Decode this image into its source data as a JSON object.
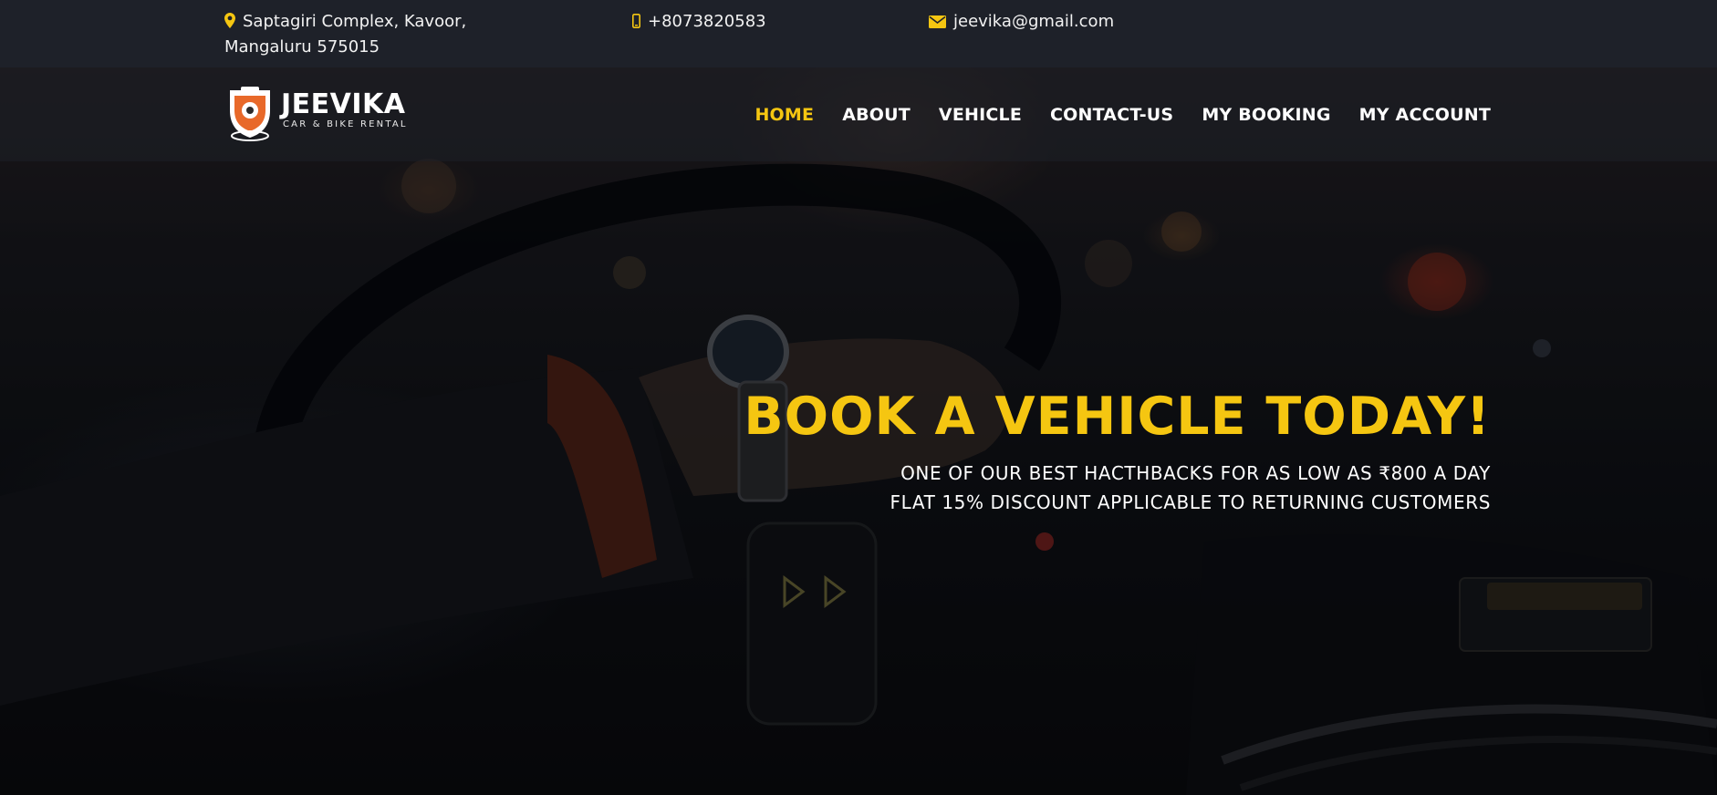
{
  "topbar": {
    "address": "Saptagiri Complex, Kavoor, Mangaluru 575015",
    "address_icon": "map-marker-icon",
    "phone": "+8073820583",
    "phone_icon": "mobile-phone-icon",
    "email": "jeevika@gmail.com",
    "email_icon": "envelope-icon"
  },
  "logo": {
    "brand": "JEEVIKA",
    "tagline": "CAR & BIKE RENTAL",
    "icon": "car-bike-logo-icon"
  },
  "nav": {
    "items": [
      {
        "label": "HOME",
        "active": true
      },
      {
        "label": "ABOUT",
        "active": false
      },
      {
        "label": "VEHICLE",
        "active": false
      },
      {
        "label": "CONTACT-US",
        "active": false
      },
      {
        "label": "MY BOOKING",
        "active": false
      },
      {
        "label": "MY ACCOUNT",
        "active": false
      }
    ]
  },
  "hero": {
    "headline": "BOOK A VEHICLE TODAY!",
    "line1": "ONE OF OUR BEST HACTHBACKS FOR AS LOW AS ₹800 A DAY",
    "line2": "FLAT 15% DISCOUNT APPLICABLE TO RETURNING CUSTOMERS"
  },
  "colors": {
    "accent": "#f5c611",
    "topbar_bg": "#1e2129",
    "logo_orange": "#e8692a"
  }
}
